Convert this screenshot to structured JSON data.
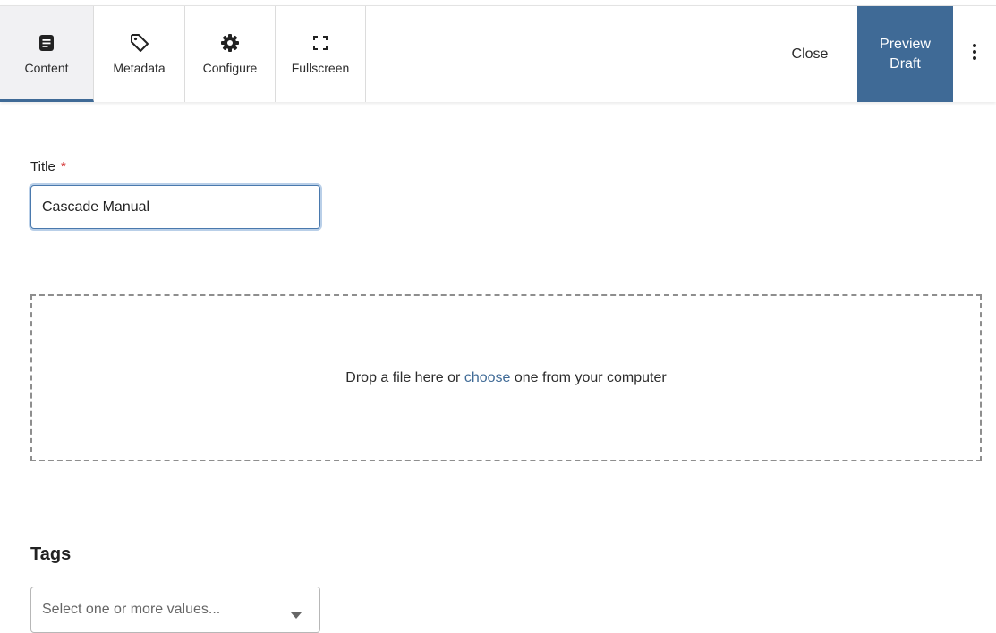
{
  "toolbar": {
    "tabs": [
      {
        "label": "Content",
        "icon": "document-icon",
        "active": true
      },
      {
        "label": "Metadata",
        "icon": "tag-icon",
        "active": false
      },
      {
        "label": "Configure",
        "icon": "gear-icon",
        "active": false
      },
      {
        "label": "Fullscreen",
        "icon": "fullscreen-icon",
        "active": false
      }
    ],
    "close_label": "Close",
    "preview_line1": "Preview",
    "preview_line2": "Draft",
    "more_icon": "vertical-ellipsis-icon"
  },
  "form": {
    "title_label": "Title",
    "required_mark": "*",
    "title_value": "Cascade Manual",
    "dropzone": {
      "text_before": "Drop a file here or ",
      "link": "choose",
      "text_after": " one from your computer"
    },
    "tags_heading": "Tags",
    "tags_placeholder": "Select one or more values..."
  },
  "colors": {
    "accent": "#3f6a96",
    "required": "#d32f2f"
  }
}
